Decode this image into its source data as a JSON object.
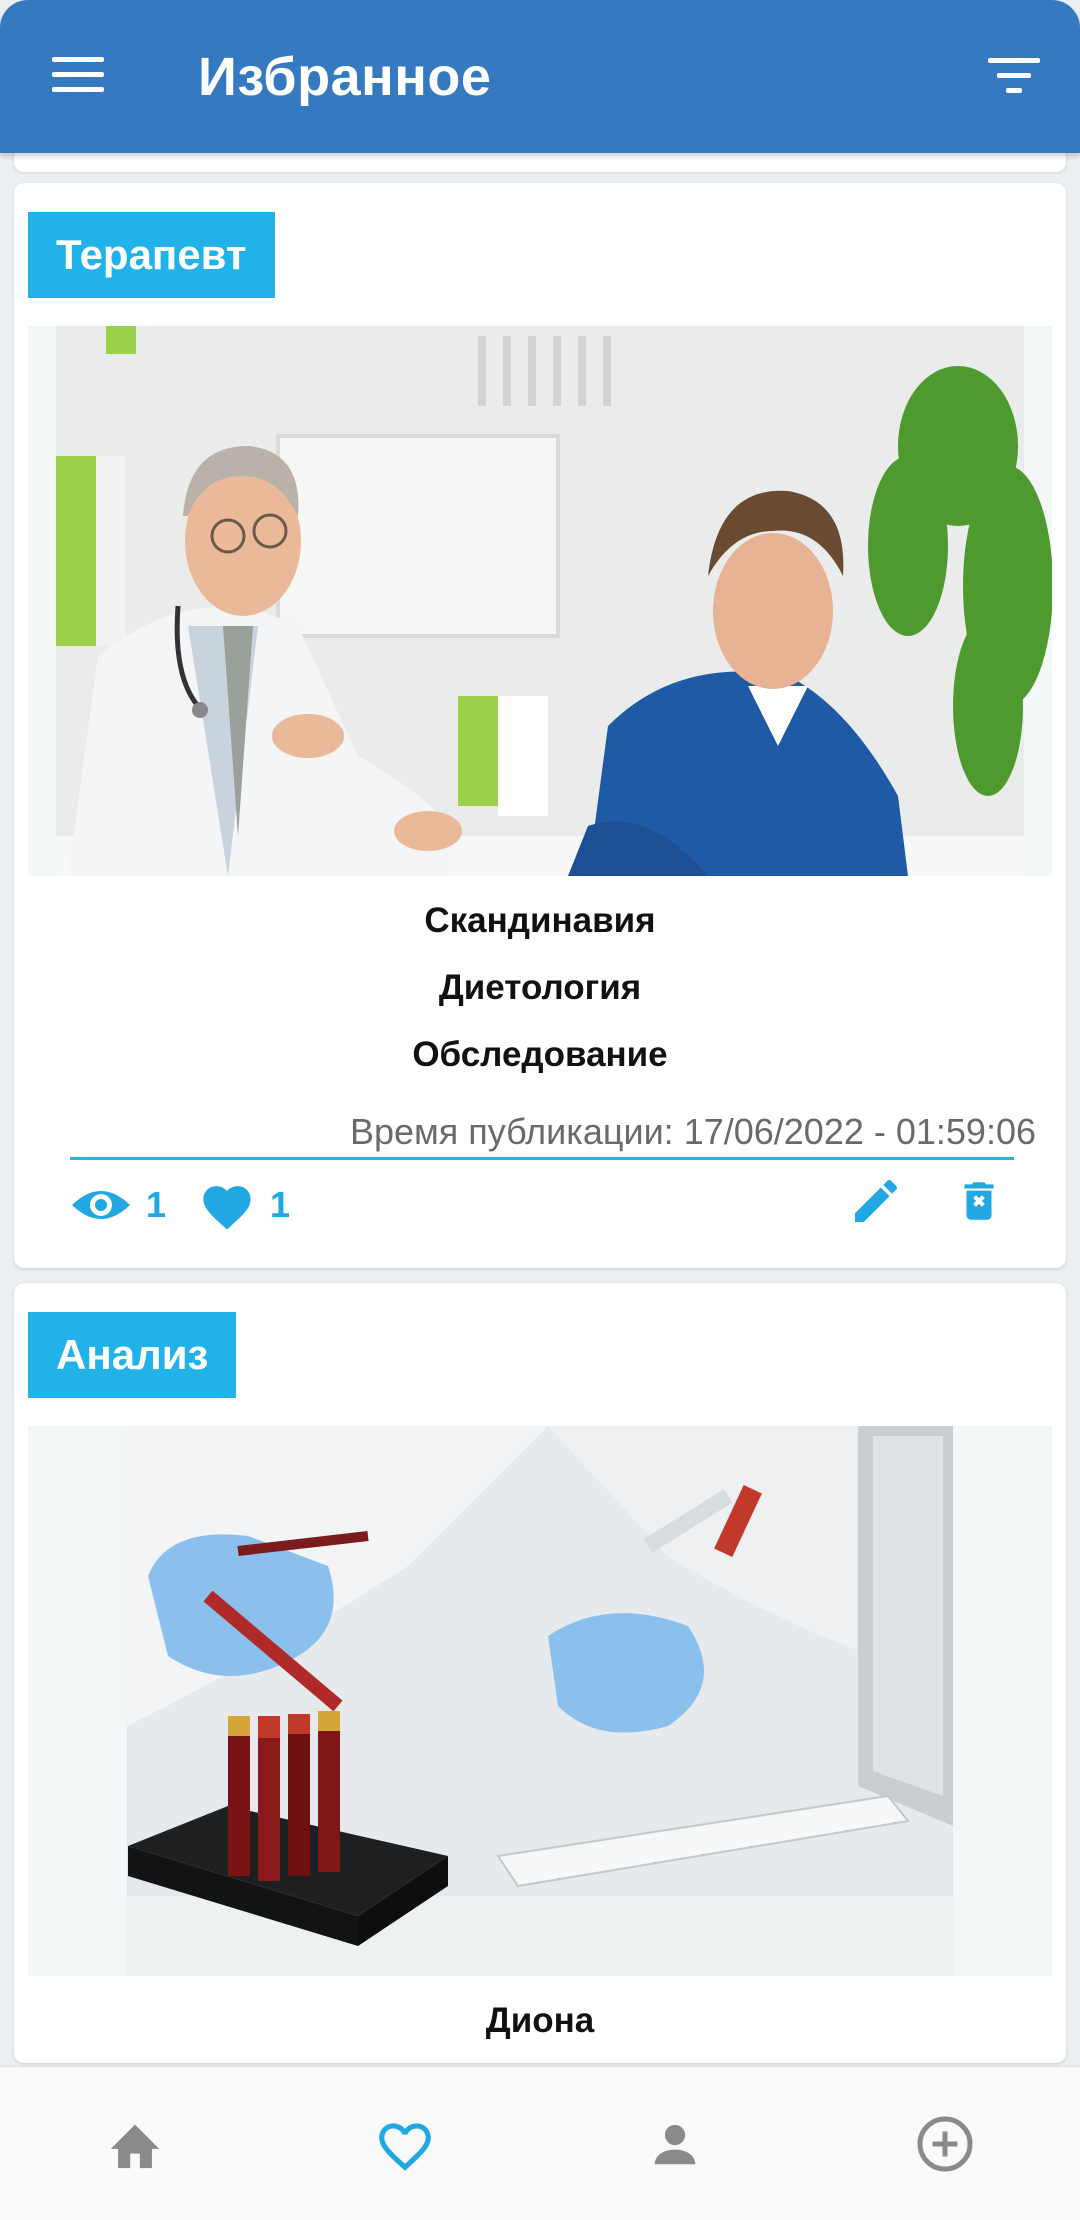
{
  "header": {
    "title": "Избранное"
  },
  "cards": [
    {
      "category": "Терапевт",
      "lines": [
        "Скандинавия",
        "Диетология",
        "Обследование"
      ],
      "date": "Время публикации: 17/06/2022 - 01:59:06",
      "views": "1",
      "likes": "1"
    },
    {
      "category": "Анализ",
      "lines": [
        "Диона"
      ]
    }
  ],
  "colors": {
    "header": "#3579c0",
    "accent": "#20b2e8",
    "icon_blue": "#21a8e2",
    "nav_grey": "#8a8a8a"
  },
  "bottom_nav": {
    "items": [
      "home-icon",
      "heart-outline-icon",
      "person-icon",
      "add-circle-icon"
    ],
    "active": "heart-outline-icon"
  }
}
